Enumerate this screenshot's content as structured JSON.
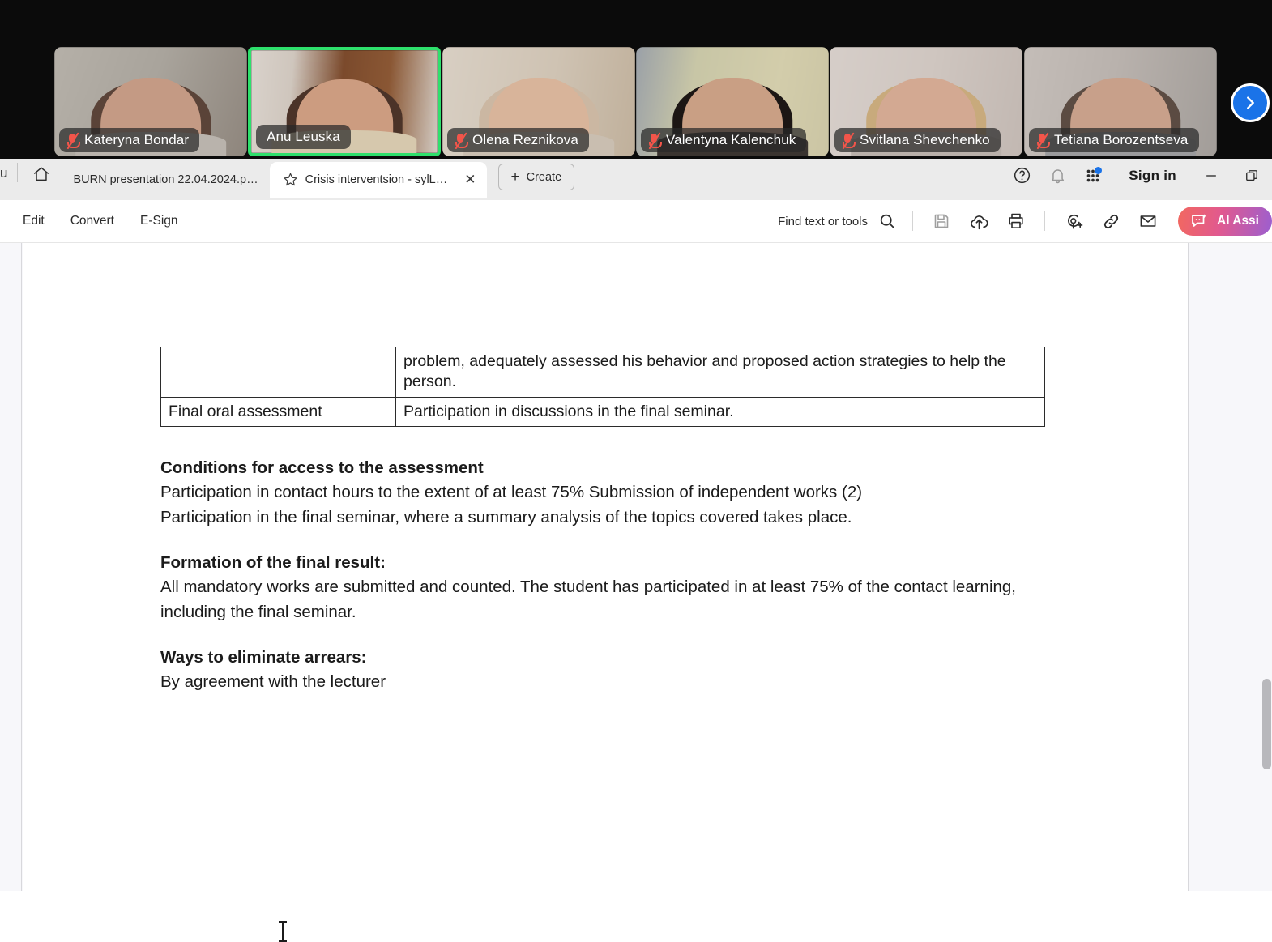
{
  "video_strip": {
    "participants": [
      {
        "name": "Kateryna Bondar",
        "muted": true,
        "active_speaker": false,
        "bg": "#a9a49c",
        "accent": "#6d5a4e",
        "skin": "#c49a84",
        "torso": "#b9b3ac"
      },
      {
        "name": "Anu Leuska",
        "muted": false,
        "active_speaker": true,
        "bg": "#b6a9a0",
        "accent": "#7b4a2c",
        "skin": "#cc9c80",
        "torso": "#d6c8ad"
      },
      {
        "name": "Olena Reznikova",
        "muted": true,
        "active_speaker": false,
        "bg": "#cfc3b3",
        "accent": "#b9a88f",
        "skin": "#d8b49a",
        "torso": "#c9beb0"
      },
      {
        "name": "Valentyna Kalenchuk",
        "muted": true,
        "active_speaker": false,
        "bg": "#cdc7a8",
        "accent": "#8d8f6a",
        "skin": "#c99f84",
        "torso": "#3a3430"
      },
      {
        "name": "Svitlana Shevchenko",
        "muted": true,
        "active_speaker": false,
        "bg": "#cfc6c0",
        "accent": "#b3a69e",
        "skin": "#d3a992",
        "torso": "#b9b0aa"
      },
      {
        "name": "Tetiana Borozentseva",
        "muted": true,
        "active_speaker": false,
        "bg": "#b9b2ad",
        "accent": "#8c8781",
        "skin": "#c8a08a",
        "torso": "#9a9a9c"
      }
    ],
    "next_button_icon": "chevron-right-icon",
    "active_border_color": "#2ee06c",
    "mute_icon_color": "#f2554a"
  },
  "tabbar": {
    "overflow_label": "u",
    "home_icon": "home-icon",
    "tabs": [
      {
        "title": "BURN presentation 22.04.2024.p…",
        "active": false,
        "starred": false
      },
      {
        "title": "Crisis interventsion - sylL…",
        "active": true,
        "starred": true
      }
    ],
    "close_label": "✕",
    "create_label": "Create",
    "create_plus": "+",
    "help_icon": "help-circle-icon",
    "bell_icon": "bell-icon",
    "apps_icon": "apps-grid-icon",
    "signin_label": "Sign in",
    "minimize_icon": "minimize-icon",
    "restore_icon": "restore-window-icon",
    "notification_dot_color": "#1a73e8"
  },
  "toolbar": {
    "menu": [
      "Edit",
      "Convert",
      "E-Sign"
    ],
    "find_label": "Find text or tools",
    "find_icon": "search-icon",
    "icons": [
      "save-icon",
      "cloud-upload-icon",
      "print-icon",
      "add-stamp-icon",
      "link-icon",
      "email-icon"
    ],
    "ai_assistant_label": "AI Assi",
    "ai_assistant_icon": "ai-sparkle-chat-icon",
    "ai_gradient_from": "#f2685f",
    "ai_gradient_to": "#9b5fd0"
  },
  "document": {
    "table": {
      "rows": [
        {
          "col_a": "",
          "col_b": "problem, adequately assessed his behavior and proposed action strategies to help the person."
        },
        {
          "col_a": "Final oral assessment",
          "col_b": "Participation in discussions in the final seminar."
        }
      ]
    },
    "sections": [
      {
        "heading": "Conditions for access to the assessment",
        "lines": [
          "Participation in contact hours to the extent of at least 75% Submission of independent works (2)",
          "Participation in the final seminar, where a summary analysis of the topics covered takes place."
        ]
      },
      {
        "heading": "Formation of the final result:",
        "lines": [
          "All mandatory works are submitted and counted. The student has participated in at least 75% of the contact learning, including the final seminar."
        ]
      },
      {
        "heading": "Ways to eliminate arrears:",
        "lines": [
          "By agreement with the lecturer"
        ]
      }
    ]
  }
}
